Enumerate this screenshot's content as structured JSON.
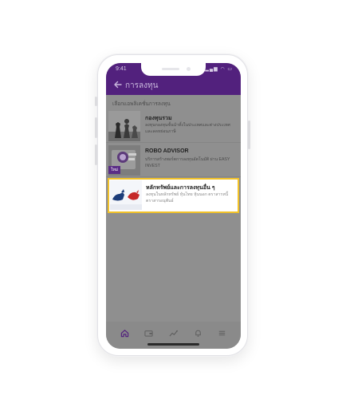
{
  "status": {
    "time": "9:41",
    "icons": "▂▄▆ ◠ ▭"
  },
  "header": {
    "title": "การลงทุน"
  },
  "section": {
    "label": "เลือกแอพลิเคชั่นการลงทุน"
  },
  "items": [
    {
      "title": "กองทุนรวม",
      "desc": "ลงทุนกองทุนชั้นนำทั้งในประเทศและต่างประเทศ และลดหย่อนภาษี",
      "thumb_icon": "chess-icon"
    },
    {
      "title": "ROBO ADVISOR",
      "desc": "บริการสร้างพอร์ตการลงทุนอัตโนมัติ ผ่าน EASY INVEST",
      "badge": "ใหม่",
      "thumb_icon": "robo-icon"
    },
    {
      "title": "หลักทรัพย์และการลงทุนอื่น ๆ",
      "desc": "ลงทุนในหลักทรัพย์ หุ้นไทย หุ้นนอก ตราสารหนี้ ตราสารอนุพันธ์",
      "thumb_icon": "bull-bear-icon"
    }
  ],
  "nav": [
    {
      "name": "home",
      "icon": "home-icon",
      "active": true
    },
    {
      "name": "wallet",
      "icon": "wallet-icon"
    },
    {
      "name": "investment",
      "icon": "chart-icon"
    },
    {
      "name": "notifications",
      "icon": "bell-icon"
    },
    {
      "name": "menu",
      "icon": "menu-icon"
    }
  ],
  "colors": {
    "primary": "#52217d",
    "highlight": "#f2c228",
    "overlay": "#8f8f8f"
  }
}
